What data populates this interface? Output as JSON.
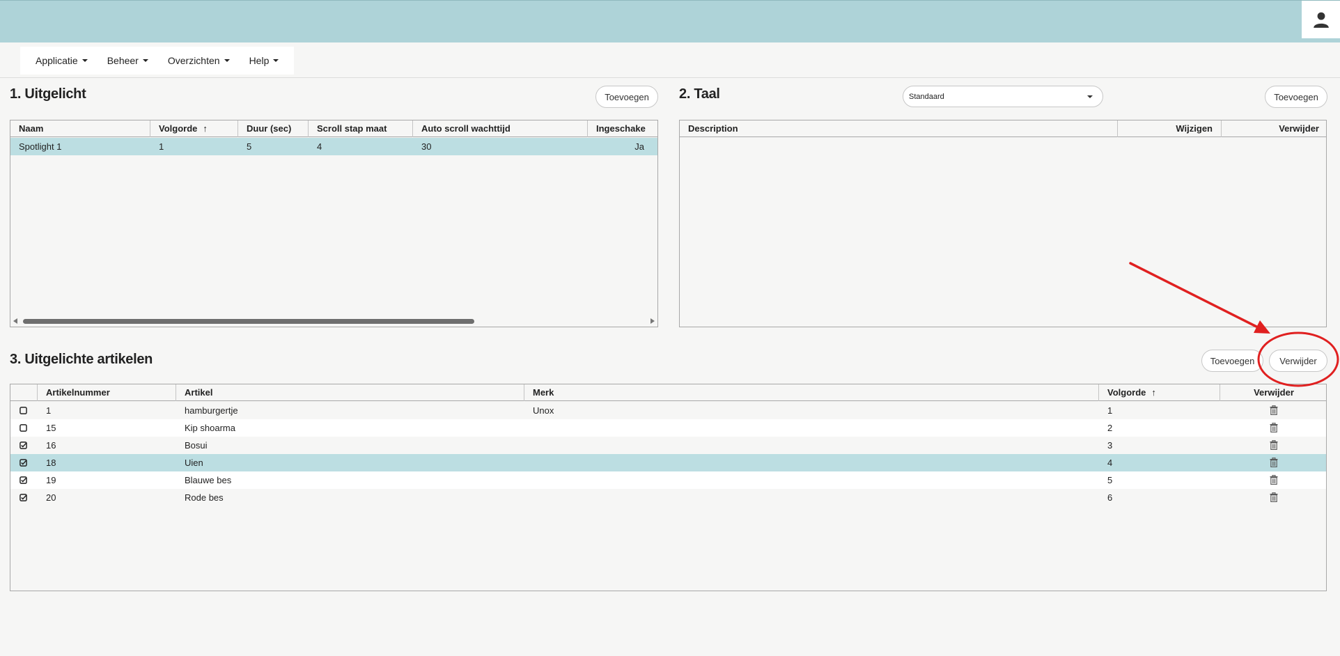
{
  "menu": [
    "Applicatie",
    "Beheer",
    "Overzichten",
    "Help"
  ],
  "section1": {
    "title": "1. Uitgelicht",
    "add_label": "Toevoegen",
    "columns": [
      "Naam",
      "Volgorde",
      "Duur (sec)",
      "Scroll stap maat",
      "Auto scroll wachttijd",
      "Ingeschake"
    ],
    "rows": [
      [
        "Spotlight 1",
        "1",
        "5",
        "4",
        "30",
        "Ja"
      ]
    ]
  },
  "section2": {
    "title": "2. Taal",
    "select_value": "Standaard",
    "add_label": "Toevoegen",
    "columns": [
      "Description",
      "Wijzigen",
      "Verwijder"
    ]
  },
  "section3": {
    "title": "3. Uitgelichte artikelen",
    "add_label": "Toevoegen",
    "remove_label": "Verwijder",
    "columns": [
      "Artikelnummer",
      "Artikel",
      "Merk",
      "Volgorde",
      "Verwijder"
    ],
    "rows": [
      {
        "checked": false,
        "cells": [
          "1",
          "hamburgertje",
          "Unox",
          "1"
        ]
      },
      {
        "checked": false,
        "cells": [
          "15",
          "Kip shoarma",
          "",
          "2"
        ]
      },
      {
        "checked": true,
        "cells": [
          "16",
          "Bosui",
          "",
          "3"
        ]
      },
      {
        "checked": true,
        "cells": [
          "18",
          "Uien",
          "",
          "4"
        ]
      },
      {
        "checked": true,
        "cells": [
          "19",
          "Blauwe bes",
          "",
          "5"
        ]
      },
      {
        "checked": true,
        "cells": [
          "20",
          "Rode bes",
          "",
          "6"
        ]
      }
    ]
  },
  "icons": {
    "user": "user-icon",
    "trash": "trash-icon",
    "checkbox": "checkbox-icon",
    "checkbox_checked": "checkbox-checked-icon",
    "sort": "sort-asc-icon"
  },
  "colors": {
    "topbar": "#aed3d8",
    "selected_row": "#bcdee2",
    "annotation": "#e02020"
  }
}
